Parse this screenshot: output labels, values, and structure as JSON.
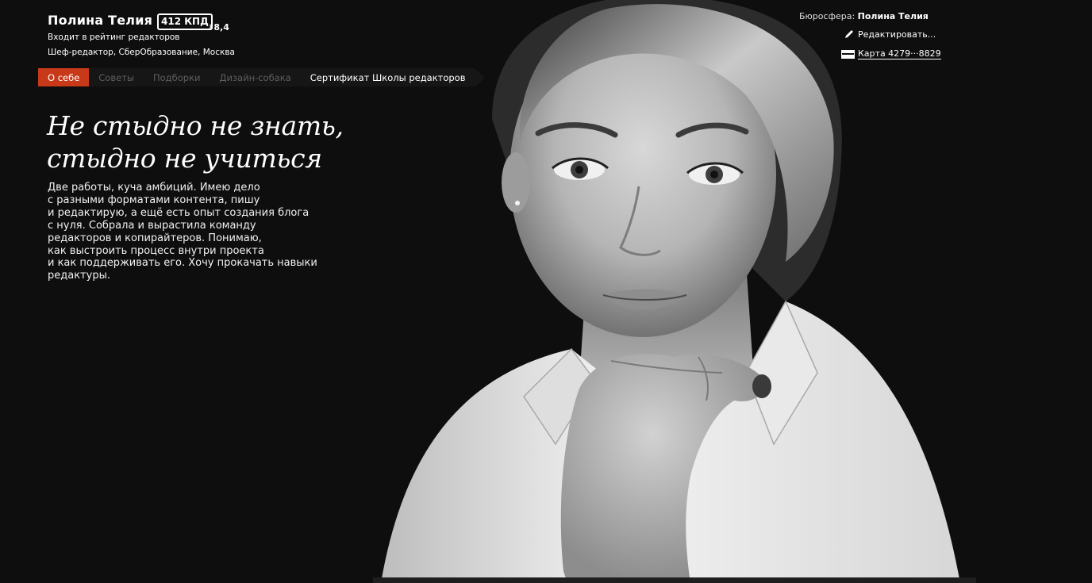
{
  "profile": {
    "name": "Полина Телия",
    "kpd_badge": "412 КПД",
    "kpd_delta": "8,4",
    "rating_note": "Входит в рейтинг редакторов",
    "job": "Шеф-редактор, СберОбразование, Москва"
  },
  "top_right": {
    "bureau_label": "Бюросфера:",
    "bureau_user": "Полина Телия",
    "edit_label": "Редактировать...",
    "card_label": "Карта 4279···8829"
  },
  "tabs": [
    {
      "label": "О себе",
      "state": "active"
    },
    {
      "label": "Советы",
      "state": "dim"
    },
    {
      "label": "Подборки",
      "state": "dim"
    },
    {
      "label": "Дизайн-собака",
      "state": "dim"
    },
    {
      "label": "Сертификат Школы редакторов",
      "state": "bright"
    }
  ],
  "headline": {
    "line1": "Не стыдно не знать,",
    "line2": "стыдно не учиться"
  },
  "bio_lines": [
    "Две работы, куча амбиций. Имею дело",
    "с разными форматами контента, пишу",
    "и редактирую, а ещё есть опыт создания блога",
    "с нуля. Собрала и вырастила команду",
    "редакторов и копирайтеров. Понимаю,",
    "как выстроить процесс внутри проекта",
    "и как поддерживать его. Хочу прокачать навыки",
    "редактуры."
  ],
  "colors": {
    "accent": "#c8391a",
    "background": "#0e0e0e",
    "tab_bar": "#161616",
    "dim_tab_text": "#5e5e5e"
  },
  "icons": {
    "edit": "pencil-icon",
    "card": "card-icon",
    "delta": "arrow-down-icon"
  }
}
